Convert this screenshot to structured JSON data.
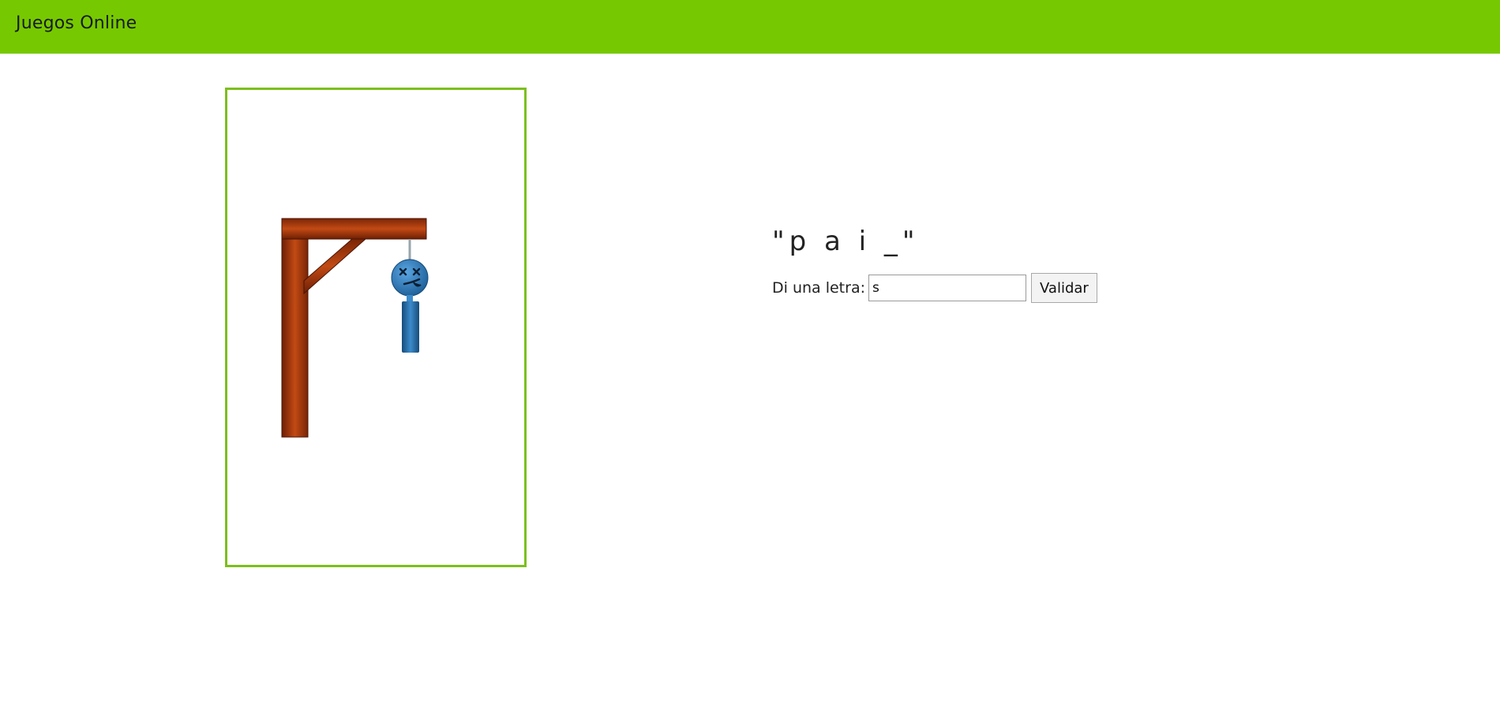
{
  "navbar": {
    "brand": "Juegos Online",
    "color": "#76c900"
  },
  "game": {
    "image_name": "hangman-image",
    "word_display": "\"p a i _\"",
    "letter_label": "Di una letra:",
    "letter_input_value": "s",
    "validate_label": "Validar"
  },
  "colors": {
    "frame_border": "#7cbf1c",
    "gallows": "#a83c10",
    "figure": "#2e79b8"
  }
}
